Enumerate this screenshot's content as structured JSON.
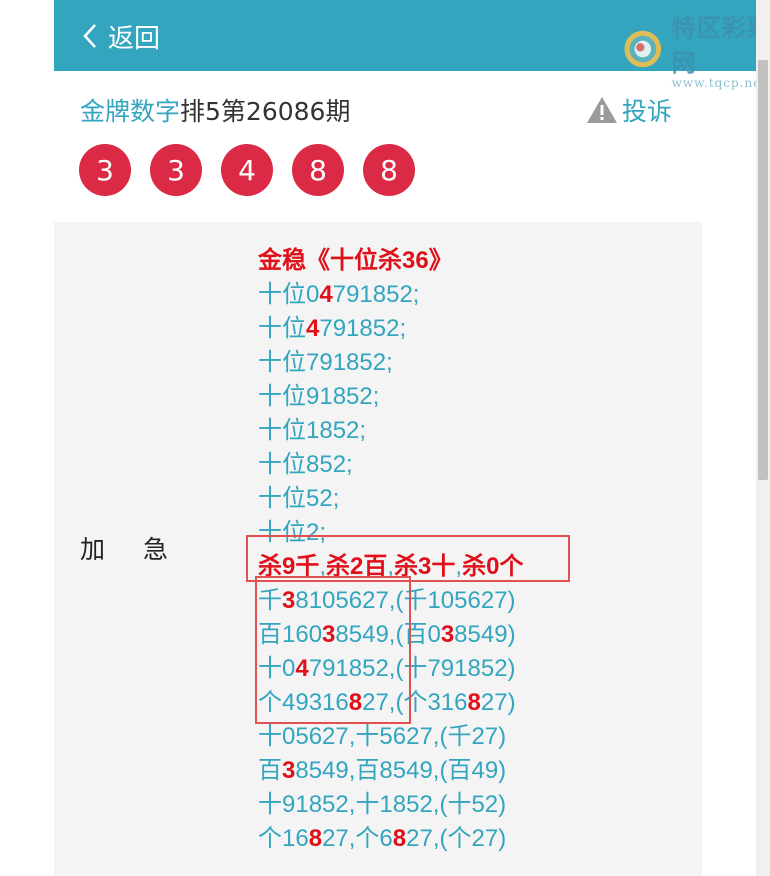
{
  "header": {
    "back_label": "返回"
  },
  "logo": {
    "name": "特区彩票网",
    "url": "www.tqcp.net"
  },
  "title": {
    "accent": "金牌数字",
    "rest": "排5第26086期"
  },
  "complain_label": "投诉",
  "balls": [
    "3",
    "3",
    "4",
    "8",
    "8"
  ],
  "row_label": "加急",
  "lines": [
    [
      {
        "t": "金稳《十位杀36》",
        "r": true
      }
    ],
    [
      {
        "t": "十位0"
      },
      {
        "t": "4",
        "r": true
      },
      {
        "t": "791852;"
      }
    ],
    [
      {
        "t": "十位"
      },
      {
        "t": "4",
        "r": true
      },
      {
        "t": "791852;"
      }
    ],
    [
      {
        "t": "十位791852;"
      }
    ],
    [
      {
        "t": "十位91852;"
      }
    ],
    [
      {
        "t": "十位1852;"
      }
    ],
    [
      {
        "t": "十位852;"
      }
    ],
    [
      {
        "t": "十位52;"
      }
    ],
    [
      {
        "t": "十位2;"
      }
    ],
    [
      {
        "t": "杀9千",
        "r": true
      },
      {
        "t": ","
      },
      {
        "t": "杀2百",
        "r": true
      },
      {
        "t": ","
      },
      {
        "t": "杀3十",
        "r": true
      },
      {
        "t": ","
      },
      {
        "t": "杀0个",
        "r": true
      }
    ],
    [
      {
        "t": "千"
      },
      {
        "t": "3",
        "r": true
      },
      {
        "t": "8105627,(千105627)"
      }
    ],
    [
      {
        "t": "百160"
      },
      {
        "t": "3",
        "r": true
      },
      {
        "t": "8549,(百0"
      },
      {
        "t": "3",
        "r": true
      },
      {
        "t": "8549)"
      }
    ],
    [
      {
        "t": "十0"
      },
      {
        "t": "4",
        "r": true
      },
      {
        "t": "791852,(十791852)"
      }
    ],
    [
      {
        "t": "个49316"
      },
      {
        "t": "8",
        "r": true
      },
      {
        "t": "27,(个316"
      },
      {
        "t": "8",
        "r": true
      },
      {
        "t": "27)"
      }
    ],
    [
      {
        "t": "十05627,十5627,(千27)"
      }
    ],
    [
      {
        "t": "百"
      },
      {
        "t": "3",
        "r": true
      },
      {
        "t": "8549,百8549,(百49)"
      }
    ],
    [
      {
        "t": "十91852,十1852,(十52)"
      }
    ],
    [
      {
        "t": "个16"
      },
      {
        "t": "8",
        "r": true
      },
      {
        "t": "27,个6"
      },
      {
        "t": "8",
        "r": true
      },
      {
        "t": "27,(个27)"
      }
    ]
  ],
  "colors": {
    "header": "#33a5bf",
    "ball": "#db2a45",
    "highlight": "#e0101a"
  }
}
